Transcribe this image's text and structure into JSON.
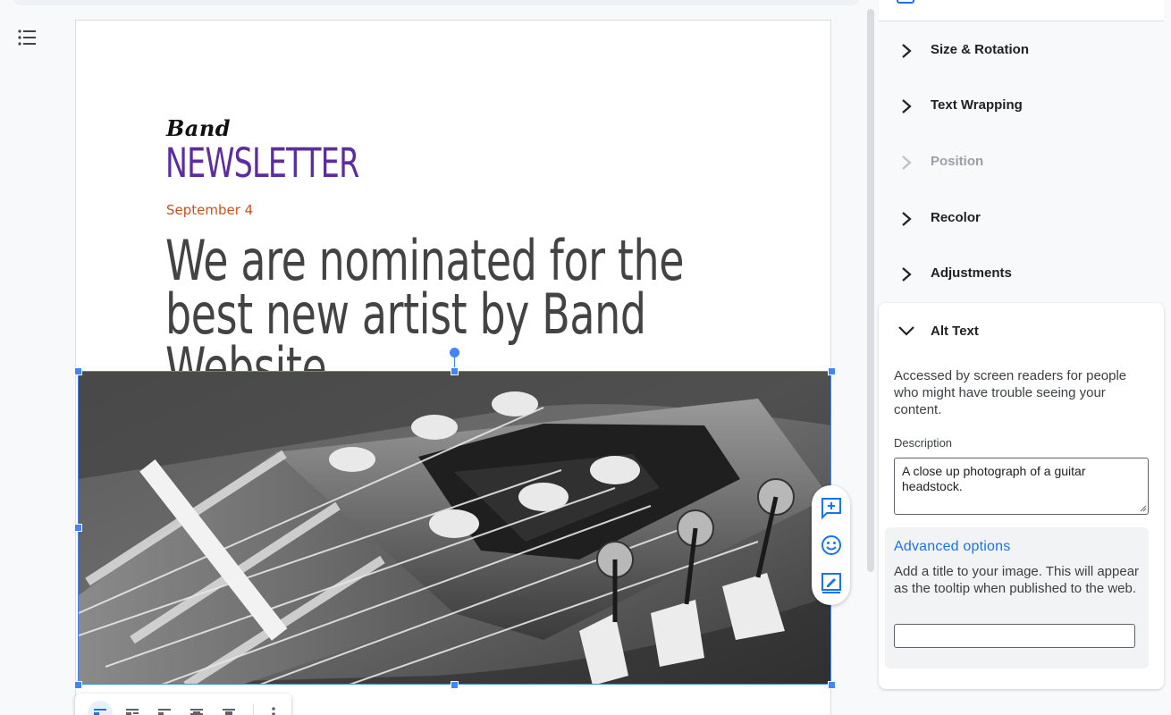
{
  "outline": {
    "icon": "list-outline-icon"
  },
  "document": {
    "brand_small": "Band",
    "brand_large": "NEWSLETTER",
    "date": "September 4",
    "headline": "We are nominated for the best new artist by Band Website",
    "image": {
      "subject": "guitar-headstock-photo"
    },
    "colors": {
      "brand": "#5b2d9e",
      "date": "#c4551f",
      "headline": "#434343",
      "selection": "#4285f4"
    }
  },
  "floating_tools": [
    "add-comment-icon",
    "emoji-reaction-icon",
    "suggest-edits-icon"
  ],
  "image_toolbar": {
    "buttons": [
      "wrap-inline-icon",
      "wrap-text-icon",
      "break-text-icon",
      "behind-text-icon",
      "in-front-of-text-icon",
      "more-options-icon"
    ]
  },
  "panel": {
    "sections": [
      {
        "label": "Size & Rotation",
        "enabled": true
      },
      {
        "label": "Text Wrapping",
        "enabled": true
      },
      {
        "label": "Position",
        "enabled": false
      },
      {
        "label": "Recolor",
        "enabled": true
      },
      {
        "label": "Adjustments",
        "enabled": true
      }
    ],
    "alt_text": {
      "heading": "Alt Text",
      "explanation": "Accessed by screen readers for people who might have trouble seeing your content.",
      "description_label": "Description",
      "description_value": "A close up photograph of a guitar headstock.",
      "advanced": {
        "title": "Advanced options",
        "text": "Add a title to your image. This will appear as the tooltip when published to the web.",
        "title_value": ""
      }
    }
  }
}
